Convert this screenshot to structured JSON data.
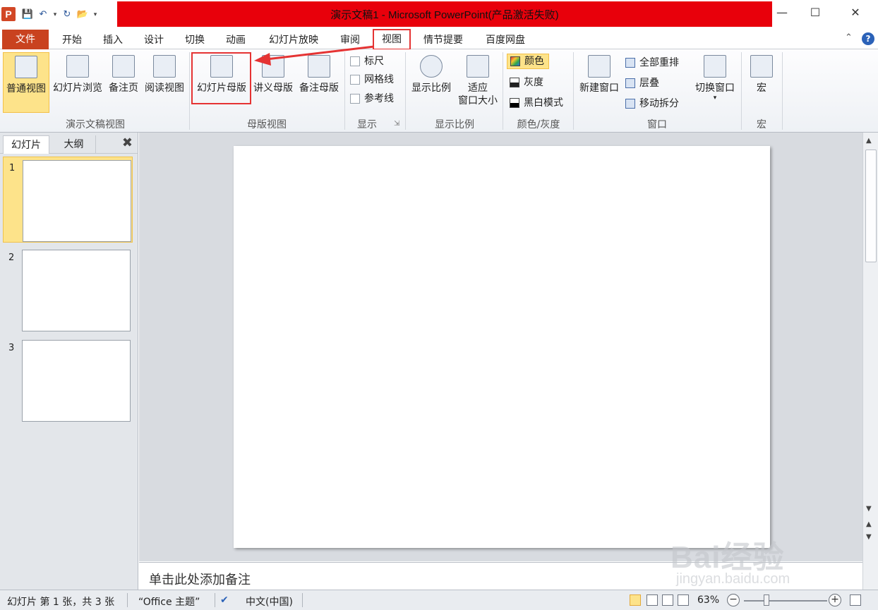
{
  "window": {
    "app_icon_letter": "P",
    "title": "演示文稿1 - Microsoft PowerPoint(产品激活失败)"
  },
  "tabs": [
    {
      "label": "文件"
    },
    {
      "label": "开始"
    },
    {
      "label": "插入"
    },
    {
      "label": "设计"
    },
    {
      "label": "切换"
    },
    {
      "label": "动画"
    },
    {
      "label": "幻灯片放映"
    },
    {
      "label": "审阅"
    },
    {
      "label": "视图"
    },
    {
      "label": "情节提要"
    },
    {
      "label": "百度网盘"
    }
  ],
  "ribbon": {
    "presentation_views": {
      "label": "演示文稿视图",
      "buttons": [
        "普通视图",
        "幻灯片浏览",
        "备注页",
        "阅读视图"
      ]
    },
    "master_views": {
      "label": "母版视图",
      "buttons": [
        "幻灯片母版",
        "讲义母版",
        "备注母版"
      ]
    },
    "show": {
      "label": "显示",
      "checkboxes": [
        "标尺",
        "网格线",
        "参考线"
      ]
    },
    "zoom": {
      "label": "显示比例",
      "zoom_button": "显示比例",
      "fit_line1": "适应",
      "fit_line2": "窗口大小"
    },
    "color": {
      "label": "颜色/灰度",
      "options": [
        "颜色",
        "灰度",
        "黑白模式"
      ]
    },
    "window": {
      "label": "窗口",
      "new_window": "新建窗口",
      "small": [
        "全部重排",
        "层叠",
        "移动拆分"
      ],
      "switch_window": "切换窗口"
    },
    "macros": {
      "label": "宏",
      "button": "宏"
    }
  },
  "left_pane": {
    "tabs": [
      "幻灯片",
      "大纲"
    ],
    "slides": [
      "1",
      "2",
      "3"
    ]
  },
  "notes": {
    "placeholder": "单击此处添加备注"
  },
  "status": {
    "slide_info": "幻灯片 第 1 张，共 3 张",
    "theme": "“Office 主题”",
    "language": "中文(中国)",
    "zoom": "63%"
  },
  "watermark": {
    "brand": "Bai经验",
    "url": "jingyan.baidu.com"
  }
}
